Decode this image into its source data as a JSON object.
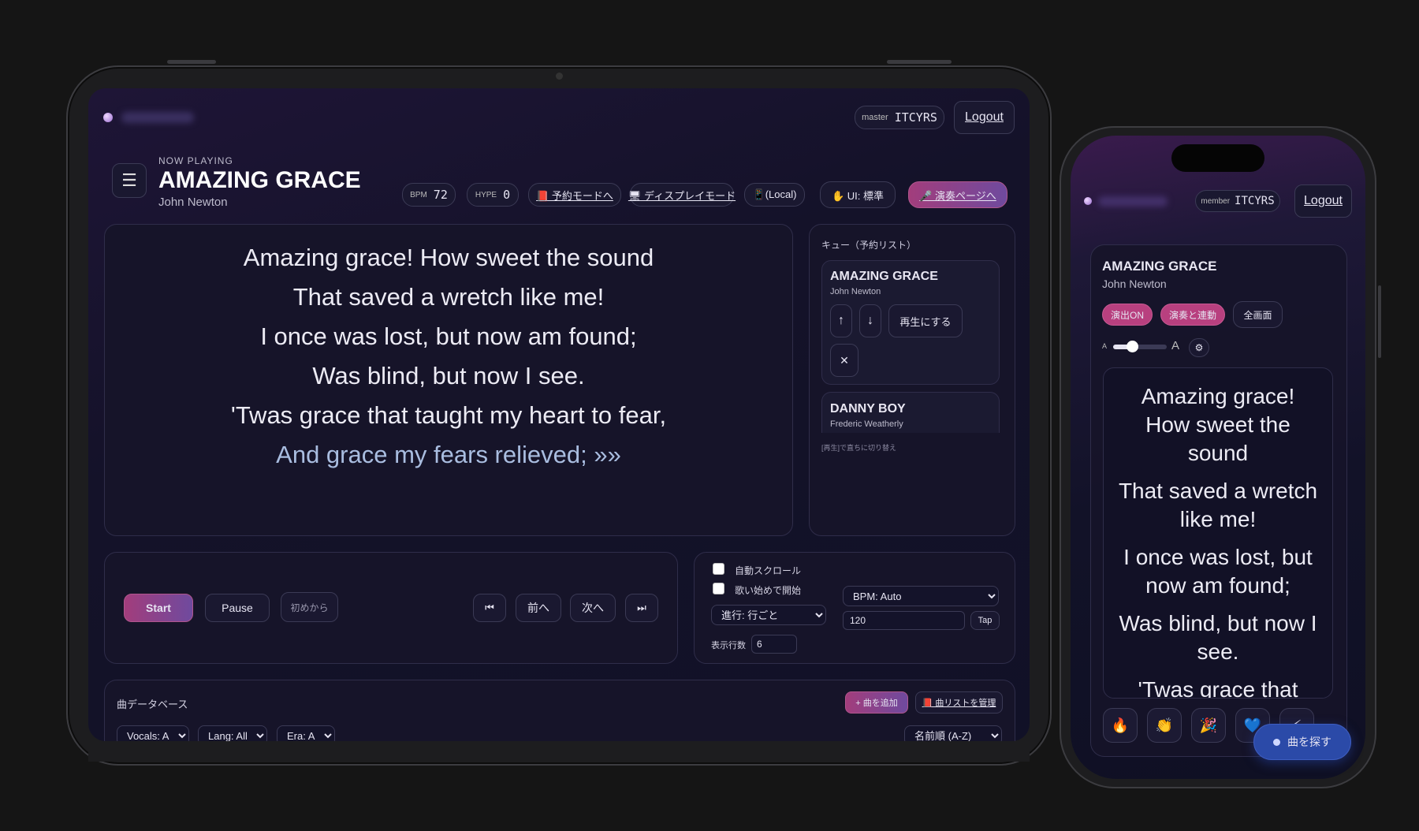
{
  "tablet": {
    "header": {
      "user_role": "master",
      "user_id": "ITCYRS",
      "logout_label": "Logout"
    },
    "now_playing": {
      "eyebrow": "NOW PLAYING",
      "title": "AMAZING GRACE",
      "artist": "John Newton"
    },
    "toolbar": {
      "bpm_label": "BPM",
      "bpm_value": "72",
      "hype_label": "HYPE",
      "hype_value": "0",
      "reserve_mode": "📕 予約モードへ",
      "display_mode": "🖥 ディスプレイモード",
      "local": "📱(Local)",
      "ui_mode": "✋ UI: 標準",
      "perform_page": "🎤 演奏ページへ"
    },
    "lyrics": [
      "Amazing grace! How sweet the sound",
      "That saved a wretch like me!",
      "I once was lost, but now am found;",
      "Was blind, but now I see.",
      "'Twas grace that taught my heart to fear,"
    ],
    "lyrics_current": "And grace my fears relieved; »»",
    "queue": {
      "title": "キュー（予約リスト）",
      "items": [
        {
          "title": "AMAZING GRACE",
          "artist": "John Newton"
        },
        {
          "title": "DANNY BOY",
          "artist": "Frederic Weatherly"
        }
      ],
      "up": "↑",
      "down": "↓",
      "play": "再生にする",
      "remove": "✕",
      "hint": "[再生]で直ちに切り替え"
    },
    "controls": {
      "start": "Start",
      "pause": "Pause",
      "restart": "初めから",
      "first": "⏮",
      "prev": "前へ",
      "next": "次へ",
      "last": "⏭"
    },
    "settings": {
      "auto_scroll": "自動スクロール",
      "start_on_sing": "歌い始めで開始",
      "progress_select": "進行: 行ごと",
      "bpm_select": "BPM: Auto",
      "bpm_input": "120",
      "tap": "Tap",
      "lines_label": "表示行数",
      "lines_value": "6"
    },
    "database": {
      "title": "曲データベース",
      "add": "+ 曲を追加",
      "manage": "📕 曲リストを管理",
      "filters": [
        "Vocals: All",
        "Lang: All",
        "Era: All"
      ],
      "sort": "名前順 (A-Z)"
    }
  },
  "phone": {
    "header": {
      "user_role": "member",
      "user_id": "ITCYRS",
      "logout_label": "Logout"
    },
    "song": {
      "title": "AMAZING GRACE",
      "artist": "John Newton"
    },
    "chips": {
      "effects": "演出ON",
      "sync": "演奏と連動",
      "fullscreen": "全画面"
    },
    "font_small": "A",
    "font_large": "A",
    "font_slider_value": 0.35,
    "settings_icon": "⚙",
    "lyrics": [
      [
        "Amazing grace!",
        "How sweet the",
        "sound"
      ],
      [
        "That saved a wretch",
        "like me!"
      ],
      [
        "I once was lost, but",
        "now am found;"
      ],
      [
        "Was blind, but now I",
        "see."
      ],
      [
        "'Twas grace that"
      ]
    ],
    "reactions": [
      "🔥",
      "👏",
      "🎉",
      "💙",
      "⚡"
    ],
    "find_song": "曲を探す"
  },
  "colors": {
    "accent": "#b8407f",
    "accent_gradient_end": "#6f4a9e",
    "current_line": "#a9bde0",
    "find_button": "#2b4aa8"
  }
}
